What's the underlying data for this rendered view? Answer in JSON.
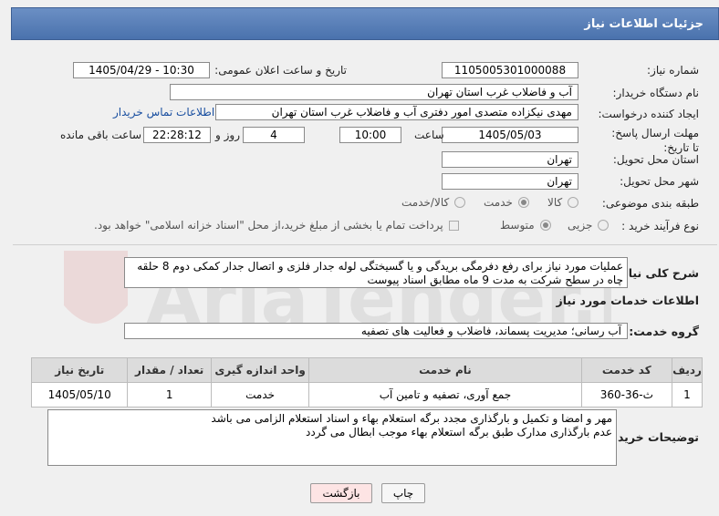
{
  "header": {
    "title": "جزئیات اطلاعات نیاز"
  },
  "need_number": {
    "label": "شماره نیاز:",
    "value": "1105005301000088"
  },
  "announce_datetime": {
    "label": "تاریخ و ساعت اعلان عمومی:",
    "value": "1405/04/29 - 10:30"
  },
  "buyer_org": {
    "label": "نام دستگاه خریدار:",
    "value": "آب و فاضلاب غرب استان تهران"
  },
  "requester": {
    "label": "ایجاد کننده درخواست:",
    "value": "مهدی نیکزاده متصدی امور دفتری آب و فاضلاب غرب استان تهران",
    "contact_link": "اطلاعات تماس خریدار"
  },
  "deadline": {
    "label": "مهلت ارسال پاسخ: تا تاریخ:",
    "date": "1405/05/03",
    "time_label": "ساعت",
    "time": "10:00",
    "days": "4",
    "days_label": "روز و",
    "remaining": "22:28:12",
    "remaining_label": "ساعت باقی مانده"
  },
  "delivery_province": {
    "label": "استان محل تحویل:",
    "value": "تهران"
  },
  "delivery_city": {
    "label": "شهر محل تحویل:",
    "value": "تهران"
  },
  "category": {
    "label": "طبقه بندی موضوعی:",
    "options": [
      "کالا",
      "خدمت",
      "کالا/خدمت"
    ],
    "selected": "خدمت"
  },
  "purchase_type": {
    "label": "نوع فرآیند خرید :",
    "options": [
      "جزیی",
      "متوسط"
    ],
    "selected": "متوسط",
    "payment_note": "پرداخت تمام یا بخشی از مبلغ خرید،از محل \"اسناد خزانه اسلامی\" خواهد بود."
  },
  "description": {
    "label": "شرح کلی نیاز:",
    "value": "عملیات مورد نیاز برای رفع دفرمگی بریدگی و یا گسیختگی لوله جدار فلزی و اتصال جدار کمکی دوم 8 حلقه چاه در سطح شرکت به مدت 9 ماه مطابق اسناد پیوست"
  },
  "services_section": {
    "title": "اطلاعات خدمات مورد نیاز"
  },
  "service_group": {
    "label": "گروه خدمت:",
    "value": "آب رسانی؛ مدیریت پسماند، فاضلاب و فعالیت های تصفیه"
  },
  "table": {
    "headers": [
      "ردیف",
      "کد خدمت",
      "نام خدمت",
      "واحد اندازه گیری",
      "تعداد / مقدار",
      "تاریخ نیاز"
    ],
    "rows": [
      [
        "1",
        "ث-36-360",
        "جمع آوری، تصفیه و تامین آب",
        "خدمت",
        "1",
        "1405/05/10"
      ]
    ]
  },
  "buyer_notes": {
    "label": "توضیحات خریدار:",
    "lines": [
      "مهر و امضا و تکمیل و بارگذاری مجدد برگه استعلام بهاء و اسناد استعلام الزامی می باشد",
      "عدم بارگذاری مدارک طبق برگه استعلام بهاء موجب ابطال می گردد"
    ]
  },
  "buttons": {
    "print": "چاپ",
    "back": "بازگشت"
  },
  "colors": {
    "header": "#4a72ad",
    "back_button_bg": "#fde4e4",
    "link": "#1a4fa0"
  },
  "watermark": {
    "text": "AriaTender.neT"
  }
}
